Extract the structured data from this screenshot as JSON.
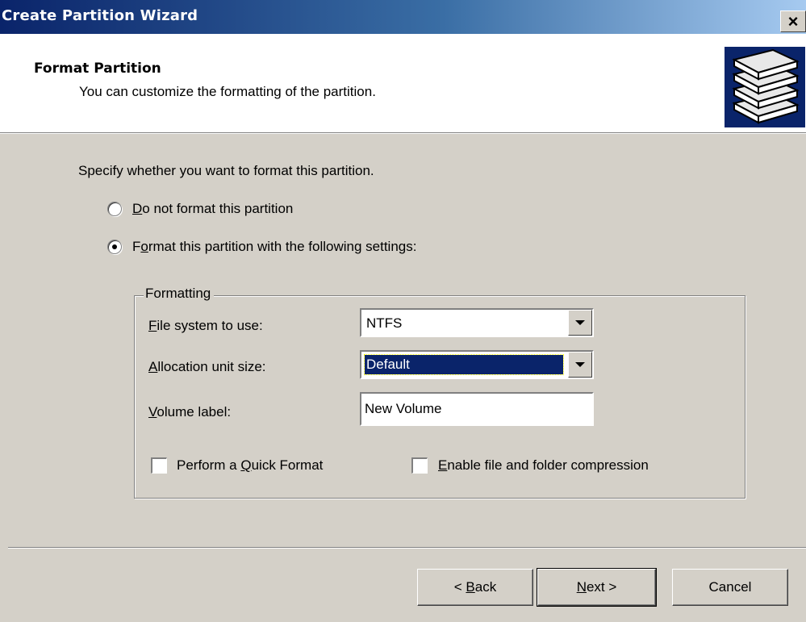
{
  "window": {
    "title": "Create Partition Wizard",
    "close_glyph": "×"
  },
  "header": {
    "title": "Format Partition",
    "subtitle": "You can customize the formatting of the partition.",
    "icon": "disk-stack-icon"
  },
  "body": {
    "instruction": "Specify whether you want to format this partition.",
    "options": [
      {
        "accel": "D",
        "rest": "o not format this partition",
        "selected": false
      },
      {
        "pre": "F",
        "accel": "o",
        "rest": "rmat this partition with the following settings:",
        "selected": true
      }
    ]
  },
  "formatting": {
    "legend": "Formatting",
    "fs_label": {
      "accel": "F",
      "rest": "ile system to use:"
    },
    "fs_value": "NTFS",
    "alloc_label": {
      "accel": "A",
      "rest": "llocation unit size:"
    },
    "alloc_value": "Default",
    "volume_label": {
      "accel": "V",
      "rest": "olume label:"
    },
    "volume_value": "New Volume",
    "quick": {
      "pre": "Perform a ",
      "accel": "Q",
      "rest": "uick Format",
      "checked": false
    },
    "compress": {
      "accel": "E",
      "rest": "nable file and folder compression",
      "checked": false
    }
  },
  "buttons": {
    "back": {
      "pre": "< ",
      "accel": "B",
      "rest": "ack"
    },
    "next": {
      "accel": "N",
      "rest": "ext >"
    },
    "cancel": "Cancel"
  },
  "colors": {
    "titlebar_start": "#0a246a",
    "titlebar_end": "#a6caf0",
    "dialog_bg": "#d4d0c8",
    "selection": "#0a246a"
  }
}
